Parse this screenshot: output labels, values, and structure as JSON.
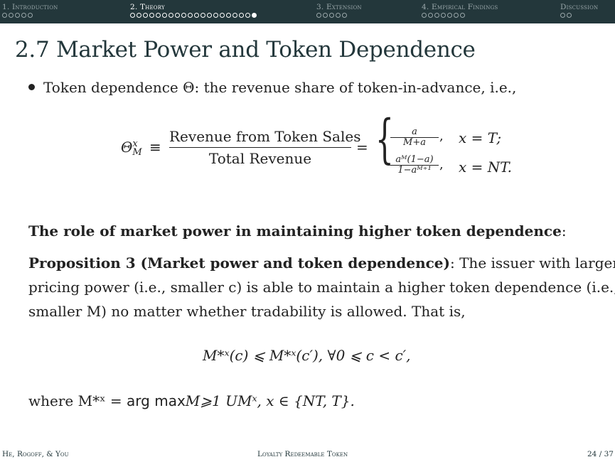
{
  "nav": {
    "sections": [
      {
        "label": "1. Introduction",
        "dots": 5,
        "filled": 0,
        "active": false
      },
      {
        "label": "2. Theory",
        "dots": 20,
        "filled": 1,
        "active": true
      },
      {
        "label": "3. Extension",
        "dots": 5,
        "filled": 0,
        "active": false
      },
      {
        "label": "4. Empirical Findings",
        "dots": 7,
        "filled": 0,
        "active": false
      },
      {
        "label": "Discussion",
        "dots": 2,
        "filled": 0,
        "active": false
      }
    ]
  },
  "slide": {
    "title": "2.7 Market Power and Token Dependence",
    "bullet": "Token dependence Θ: the revenue share of token-in-advance, i.e.,",
    "formula": {
      "lhs_base": "Θ",
      "lhs_sup": "x",
      "lhs_sub": "M",
      "equiv": "≡",
      "numerator": "Revenue from Token Sales",
      "denominator": "Total Revenue",
      "eq": "=",
      "brace": "{",
      "case1_num": "a",
      "case1_den": "M+a",
      "case1_cond": "x = T;",
      "case2_num": "aᴹ(1−a)",
      "case2_den": "1−aᴹ⁺¹",
      "case2_cond": "x = NT.",
      "comma": ","
    },
    "role_heading": "The role of market power in maintaining higher token dependence",
    "role_colon": ":",
    "prop_label": "Proposition 3 (Market power and token dependence)",
    "prop_line1_rest": ": The issuer with larger",
    "prop_line2": "pricing power (i.e., smaller c) is able to maintain a higher token dependence (i.e.,",
    "prop_line3": "smaller M) no matter whether tradability is allowed. That is,",
    "formula2": "M*ˣ(c) ⩽ M*ˣ(c′),    ∀0 ⩽ c < c′,",
    "where_prefix": "where M*ˣ = ",
    "where_argmax": "arg max",
    "where_rest": "M⩾1 UMˣ, x ∈ {NT, T}."
  },
  "footer": {
    "authors": "He, Rogoff, & You",
    "title": "Loyalty Redeemable Token",
    "page": "24 / 37"
  },
  "colors": {
    "navbar": "#23373b",
    "nav_inactive": "#9aa7aa",
    "nav_active": "#ffffff",
    "title": "#23373b"
  }
}
